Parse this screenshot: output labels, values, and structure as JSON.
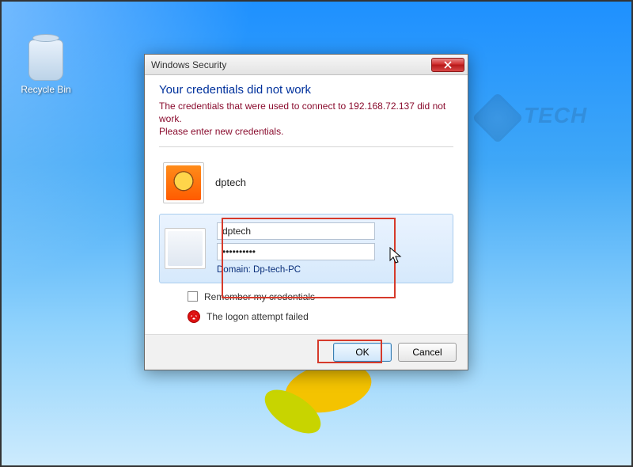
{
  "desktop": {
    "recycle_bin_label": "Recycle Bin",
    "watermark_text": "TECH"
  },
  "dialog": {
    "title": "Windows Security",
    "heading": "Your credentials did not work",
    "message1": "The credentials that were used to connect to 192.168.72.137 did not work.",
    "message2": "Please enter new credentials.",
    "saved_user": "dptech",
    "username_value": "dptech",
    "password_value": "••••••••••",
    "domain_label": "Domain: Dp-tech-PC",
    "remember_label": "Remember my credentials",
    "error_text": "The logon attempt failed",
    "ok_label": "OK",
    "cancel_label": "Cancel"
  }
}
